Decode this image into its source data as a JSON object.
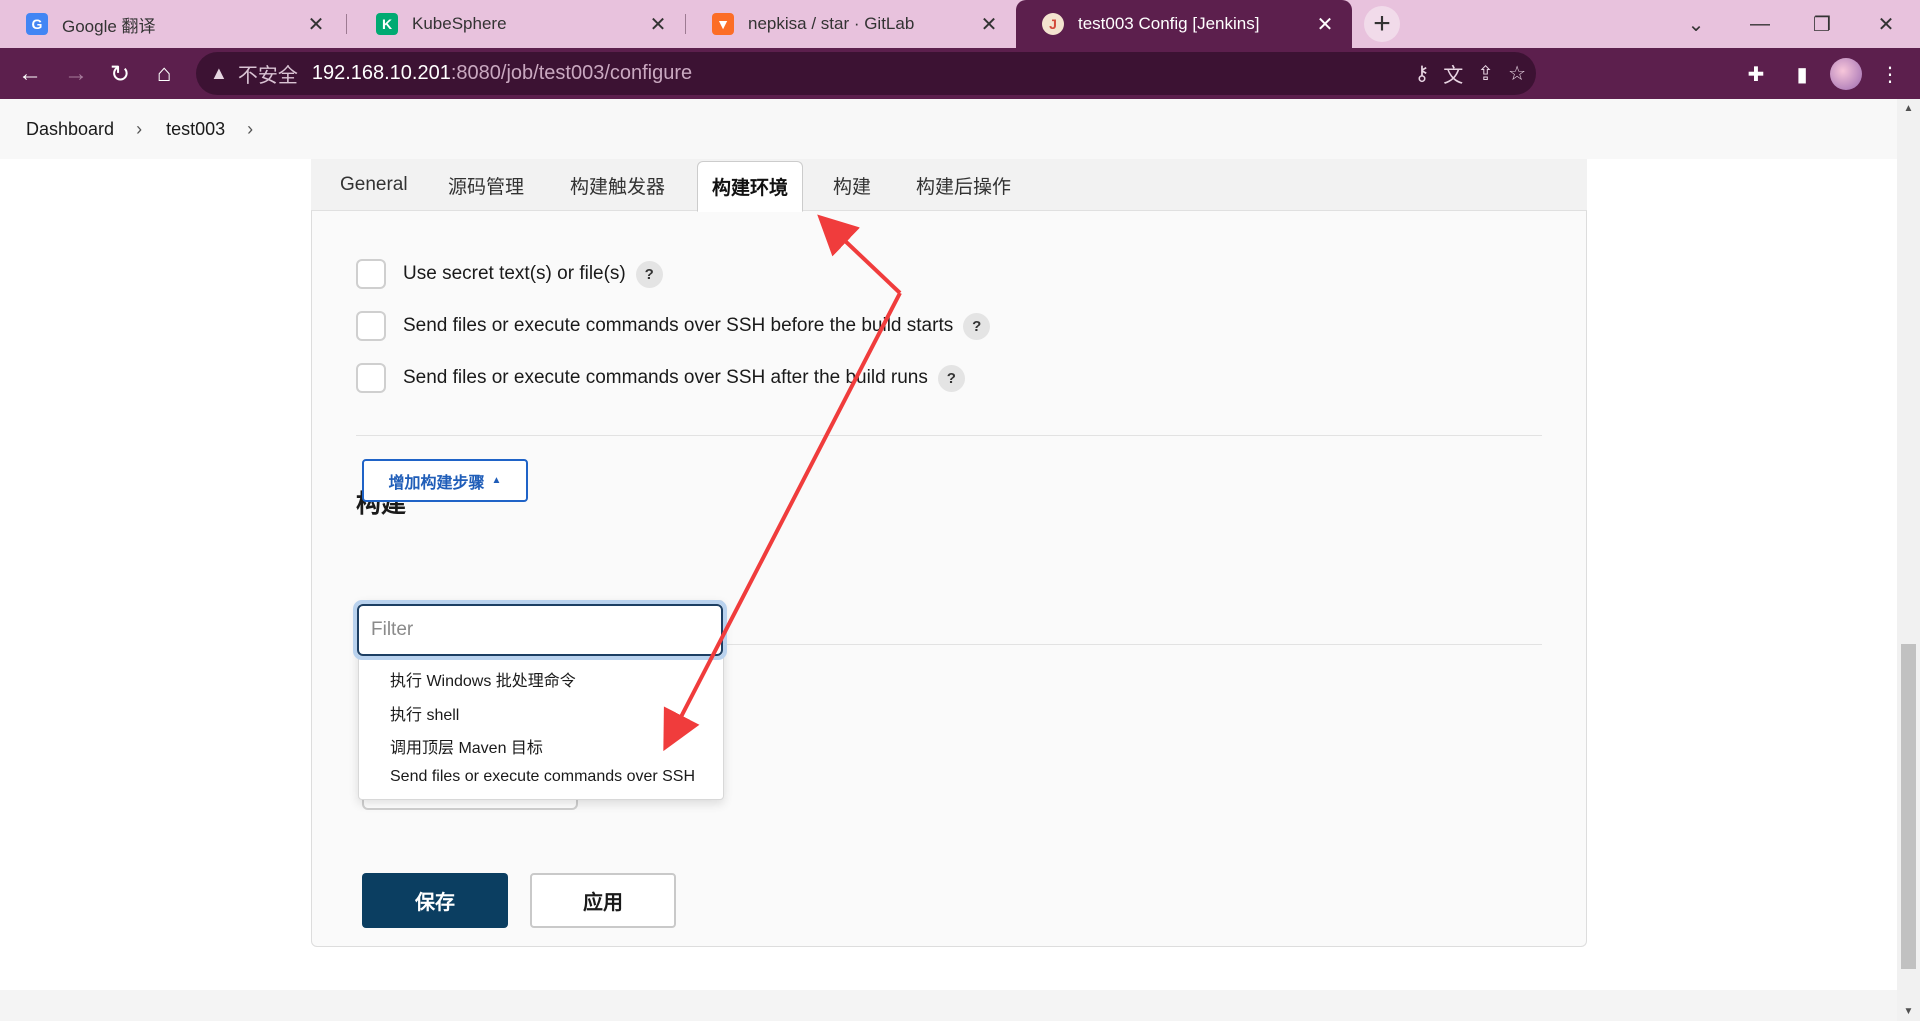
{
  "browser": {
    "tabs": [
      {
        "title": "Google 翻译",
        "icon": "google-translate-icon",
        "icon_color": "#4285f4"
      },
      {
        "title": "KubeSphere",
        "icon": "kubesphere-icon",
        "icon_color": "#00aa72"
      },
      {
        "title": "nepkisa / star · GitLab",
        "icon": "gitlab-icon",
        "icon_color": "#fc6d26"
      },
      {
        "title": "test003 Config [Jenkins]",
        "icon": "jenkins-icon",
        "icon_color": "#d24939"
      }
    ],
    "active_tab": 3,
    "address": {
      "security_label": "不安全",
      "host": "192.168.10.201",
      "path": ":8080/job/test003/configure"
    },
    "theme_color": "#5c1f4d"
  },
  "breadcrumb": {
    "items": [
      "Dashboard",
      "test003"
    ]
  },
  "config_tabs": [
    "General",
    "源码管理",
    "构建触发器",
    "构建环境",
    "构建",
    "构建后操作"
  ],
  "active_config_tab": "构建环境",
  "build_env_options": [
    {
      "label": "Use secret text(s) or file(s)",
      "checked": false
    },
    {
      "label": "Send files or execute commands over SSH before the build starts",
      "checked": false
    },
    {
      "label": "Send files or execute commands over SSH after the build runs",
      "checked": false
    }
  ],
  "build_section": {
    "title": "构建",
    "add_step_label": "增加构建步骤",
    "filter_placeholder": "Filter",
    "menu_items": [
      "执行 Windows 批处理命令",
      "执行 shell",
      "调用顶层 Maven 目标",
      "Send files or execute commands over SSH"
    ]
  },
  "actions": {
    "save_label": "保存",
    "apply_label": "应用"
  },
  "colors": {
    "primary_button": "#0b3e61",
    "link_blue": "#1f5db8",
    "annotation_red": "#f03c3c"
  }
}
